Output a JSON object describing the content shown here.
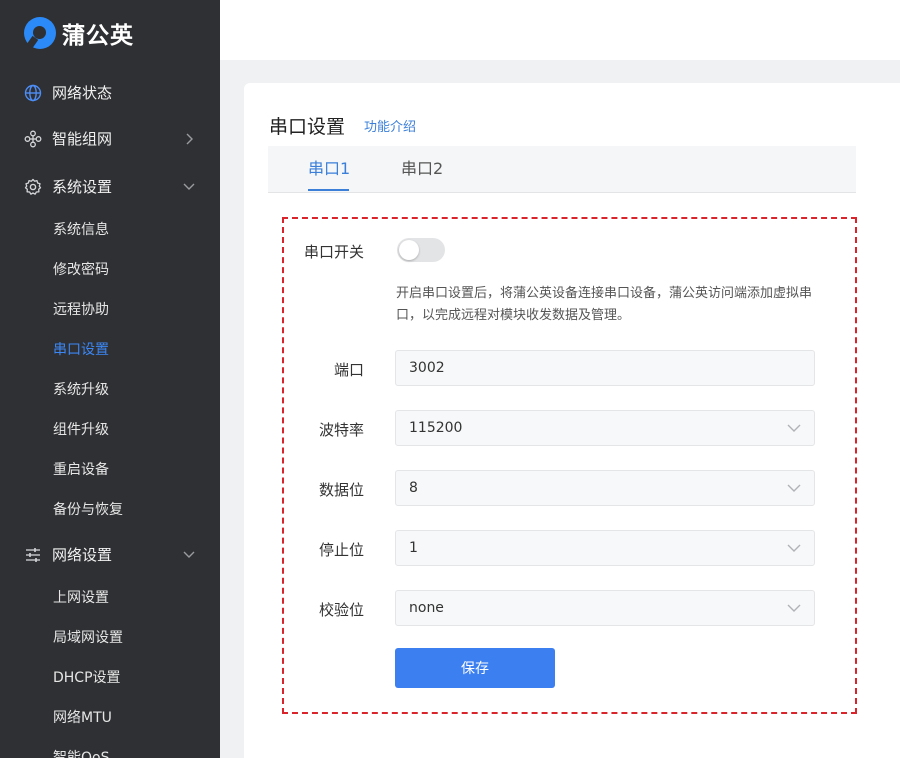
{
  "brand": {
    "name": "蒲公英"
  },
  "sidebar": {
    "groups": [
      {
        "label": "网络状态",
        "icon": "globe-icon"
      },
      {
        "label": "智能组网",
        "icon": "network-nodes-icon"
      },
      {
        "label": "系统设置",
        "icon": "gear-icon"
      },
      {
        "label": "网络设置",
        "icon": "sliders-icon"
      }
    ],
    "system_items": [
      "系统信息",
      "修改密码",
      "远程协助",
      "串口设置",
      "系统升级",
      "组件升级",
      "重启设备",
      "备份与恢复"
    ],
    "network_items": [
      "上网设置",
      "局域网设置",
      "DHCP设置",
      "网络MTU",
      "智能QoS"
    ],
    "active_item": "串口设置"
  },
  "page": {
    "title": "串口设置",
    "intro_link": "功能介绍",
    "tabs": [
      "串口1",
      "串口2"
    ],
    "active_tab": "串口1"
  },
  "form": {
    "switch_label": "串口开关",
    "switch_on": false,
    "hint": "开启串口设置后，将蒲公英设备连接串口设备，蒲公英访问端添加虚拟串口，以完成远程对模块收发数据及管理。",
    "port": {
      "label": "端口",
      "value": "3002"
    },
    "baud": {
      "label": "波特率",
      "value": "115200"
    },
    "data_bits": {
      "label": "数据位",
      "value": "8"
    },
    "stop_bits": {
      "label": "停止位",
      "value": "1"
    },
    "parity": {
      "label": "校验位",
      "value": "none"
    },
    "save_label": "保存"
  },
  "colors": {
    "accent": "#3b7ff0",
    "sidebar_bg": "#2f3033",
    "highlight_border": "#d9242b"
  }
}
